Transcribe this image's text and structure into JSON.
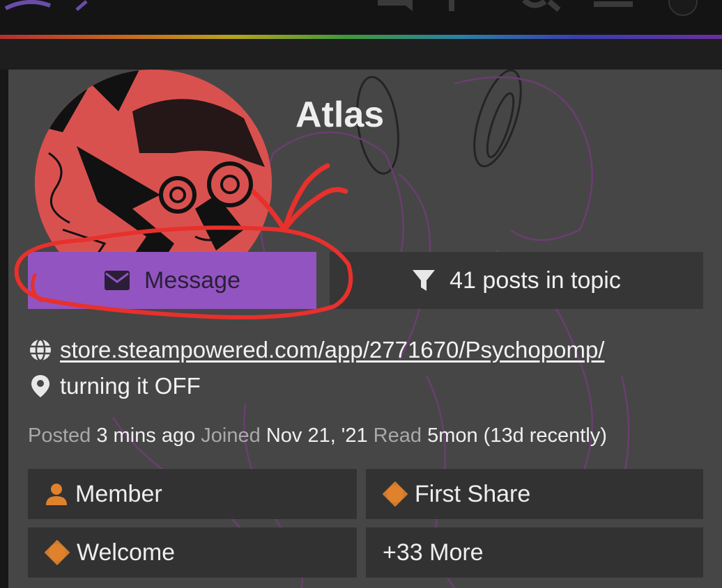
{
  "nav": {
    "icons": [
      "logo-icon",
      "chat-icon",
      "pin-icon",
      "search-icon",
      "menu-icon",
      "avatar-icon"
    ]
  },
  "profile": {
    "username": "Atlas",
    "avatar": "avatar-image"
  },
  "actions": {
    "message_label": "Message",
    "posts_label": "41 posts in topic"
  },
  "info": {
    "website": "store.steampowered.com/app/2771670/Psychopomp/",
    "location": "turning it OFF"
  },
  "stats": {
    "posted_label": "Posted",
    "posted_value": "3 mins ago",
    "joined_label": "Joined",
    "joined_value": "Nov 21, '21",
    "read_label": "Read",
    "read_value": "5mon (13d recently)"
  },
  "badges": [
    {
      "label": "Member",
      "icon": "user-icon"
    },
    {
      "label": "First Share",
      "icon": "badge-icon"
    },
    {
      "label": "Welcome",
      "icon": "badge-icon"
    },
    {
      "label": "+33 More",
      "icon": ""
    }
  ],
  "colors": {
    "accent": "#9254c1",
    "badge_icon": "#e0822c",
    "annotation": "#e8302c",
    "card_bg": "#464646"
  }
}
